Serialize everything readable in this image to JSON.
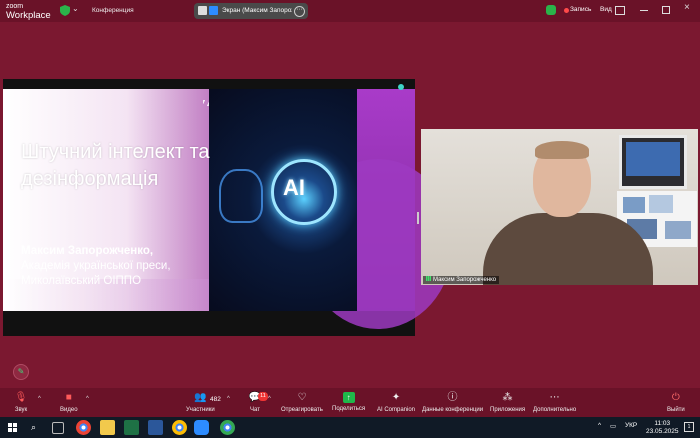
{
  "app": {
    "logo_line1": "zoom",
    "logo_line2": "Workplace"
  },
  "topbar": {
    "conference_label": "Конференция",
    "share_label": "Экран (Максим Запорожче",
    "recording_label": "Запись",
    "view_label": "Вид"
  },
  "slide": {
    "title_line1": "Штучний інтелект та",
    "title_line2": "дезінформація",
    "author_name": "Максим Запорожченко,",
    "author_line2": "Академія української преси,",
    "author_line3": "Миколаївський ОІППО",
    "ai_text": "AI"
  },
  "video": {
    "participant_name": "Максим Запорожченко"
  },
  "toolbar": {
    "audio": "Звук",
    "video": "Видео",
    "participants": "Участники",
    "participants_count": "482",
    "chat": "Чат",
    "chat_badge": "11",
    "react": "Отреагировать",
    "share": "Поделиться",
    "ai": "AI Companion",
    "info": "Данные конференции",
    "apps": "Приложения",
    "more": "Дополнительно",
    "leave": "Выйти"
  },
  "taskbar": {
    "lang": "УКР",
    "time": "11:03",
    "date": "23.05.2025",
    "notif": "1"
  },
  "colors": {
    "zoom_bg": "#7b1830",
    "toolbar": "#6a1228",
    "share_green": "#1fb84a",
    "record_red": "#ff4a4a"
  }
}
